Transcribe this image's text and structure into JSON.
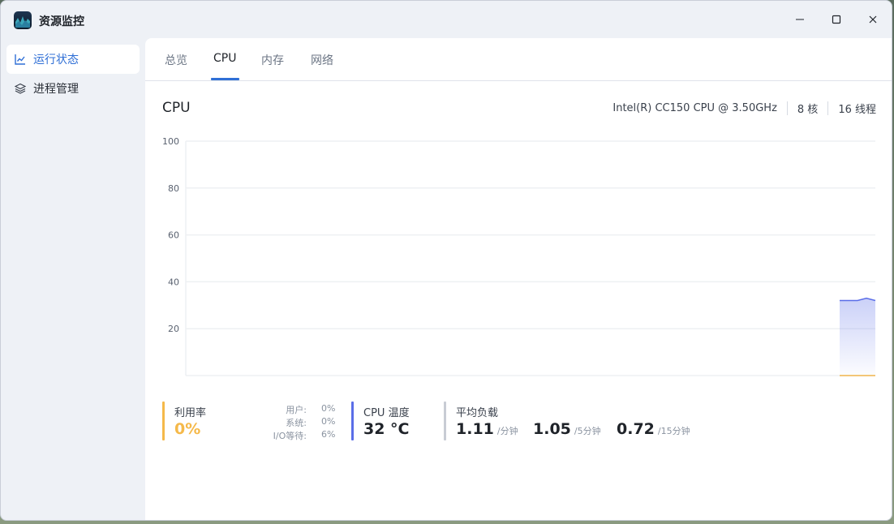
{
  "window": {
    "title": "资源监控",
    "controls": {
      "minimize": "minimize-icon",
      "maximize": "maximize-icon",
      "close": "close-icon"
    }
  },
  "sidebar": {
    "items": [
      {
        "label": "运行状态",
        "icon": "line-chart-icon",
        "active": true
      },
      {
        "label": "进程管理",
        "icon": "layers-icon",
        "active": false
      }
    ]
  },
  "tabs": [
    {
      "label": "总览",
      "active": false
    },
    {
      "label": "CPU",
      "active": true
    },
    {
      "label": "内存",
      "active": false
    },
    {
      "label": "网络",
      "active": false
    }
  ],
  "cpu": {
    "title": "CPU",
    "model": "Intel(R) CC150 CPU @ 3.50GHz",
    "cores": "8 核",
    "threads": "16 线程"
  },
  "chart_data": {
    "type": "area",
    "title": "",
    "xlabel": "",
    "ylabel": "",
    "ylim": [
      0,
      100
    ],
    "yticks": [
      20,
      40,
      60,
      80,
      100
    ],
    "grid": true,
    "series": [
      {
        "color": "#5b6ee8",
        "values": [
          32,
          32,
          32,
          33,
          32
        ]
      },
      {
        "color": "#f0b44c",
        "values": [
          0,
          0,
          0,
          0,
          0
        ]
      }
    ]
  },
  "stats": {
    "usage": {
      "label": "利用率",
      "value": "0%",
      "color": "#f5b94a",
      "breakdown": [
        {
          "label": "用户:",
          "value": "0%"
        },
        {
          "label": "系统:",
          "value": "0%"
        },
        {
          "label": "I/O等待:",
          "value": "6%"
        }
      ]
    },
    "temperature": {
      "label": "CPU 温度",
      "value": "32 °C",
      "color": "#5b6ee8"
    },
    "load": {
      "label": "平均负载",
      "color": "#c8ccd4",
      "items": [
        {
          "value": "1.11",
          "unit": "/分钟"
        },
        {
          "value": "1.05",
          "unit": "/5分钟"
        },
        {
          "value": "0.72",
          "unit": "/15分钟"
        }
      ]
    }
  }
}
